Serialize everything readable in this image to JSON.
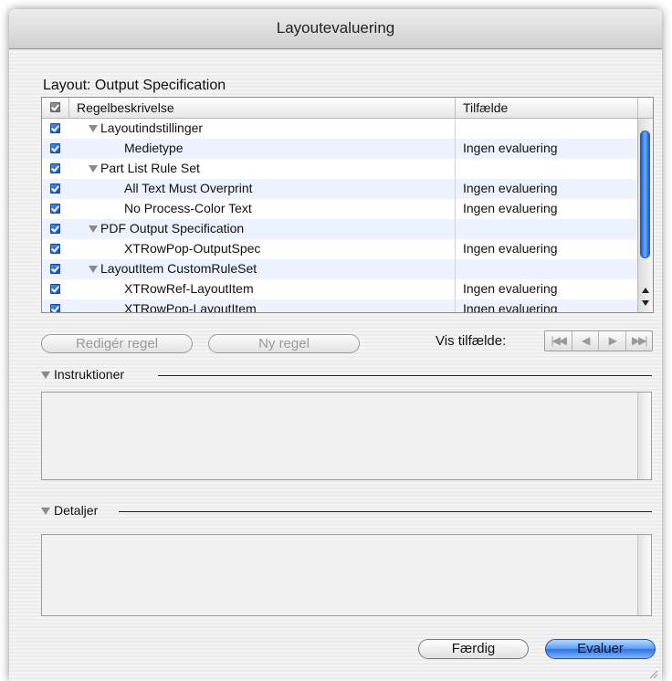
{
  "window": {
    "title": "Layoutevaluering"
  },
  "layout_label": "Layout: Output Specification",
  "table": {
    "columns": {
      "desc": "Regelbeskrivelse",
      "case": "Tilfælde"
    },
    "rows": [
      {
        "desc": "Layoutindstillinger",
        "case": "",
        "group": true
      },
      {
        "desc": "Medietype",
        "case": "Ingen evaluering",
        "group": false
      },
      {
        "desc": "Part List Rule Set",
        "case": "",
        "group": true
      },
      {
        "desc": "All Text Must Overprint",
        "case": "Ingen evaluering",
        "group": false
      },
      {
        "desc": "No Process-Color Text",
        "case": "Ingen evaluering",
        "group": false
      },
      {
        "desc": "PDF Output Specification",
        "case": "",
        "group": true
      },
      {
        "desc": "XTRowPop-OutputSpec",
        "case": "Ingen evaluering",
        "group": false
      },
      {
        "desc": "LayoutItem CustomRuleSet",
        "case": "",
        "group": true
      },
      {
        "desc": "XTRowRef-LayoutItem",
        "case": "Ingen evaluering",
        "group": false
      },
      {
        "desc": "XTRowPop-LayoutItem",
        "case": "Ingen evaluering",
        "group": false
      }
    ]
  },
  "buttons": {
    "edit_rule": "Redigér regel",
    "new_rule": "Ny regel",
    "done": "Færdig",
    "evaluate": "Evaluer"
  },
  "show_cases_label": "Vis tilfælde:",
  "nav_icons": [
    "first-icon",
    "previous-icon",
    "next-icon",
    "last-icon"
  ],
  "sections": {
    "instructions": "Instruktioner",
    "details": "Detaljer"
  },
  "colors": {
    "accent": "#3f86ee",
    "checkbox": "#2a6ee0"
  }
}
